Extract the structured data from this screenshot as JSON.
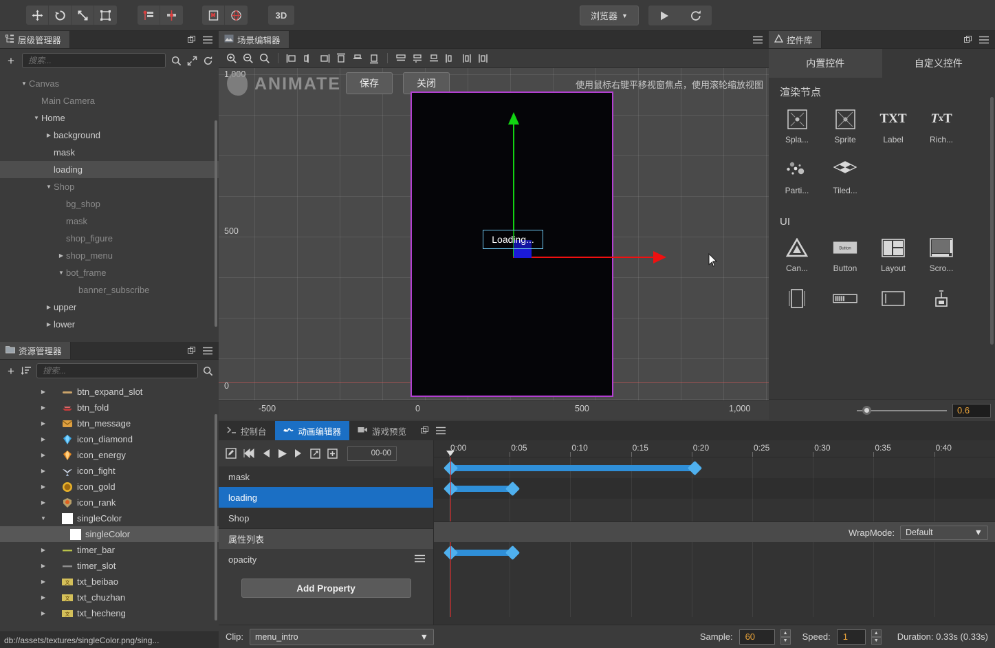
{
  "toolbar": {
    "transform_tools": [
      {
        "name": "move-tool",
        "icon": "move"
      },
      {
        "name": "rotate-tool",
        "icon": "rotate"
      },
      {
        "name": "scale-tool",
        "icon": "scale"
      },
      {
        "name": "rect-tool",
        "icon": "rect"
      }
    ],
    "pivot_tools": [
      {
        "name": "pivot-tool",
        "icon": "pivot"
      },
      {
        "name": "anchor-tool",
        "icon": "anchor"
      }
    ],
    "coord_tools": [
      {
        "name": "local-coord-tool",
        "icon": "local"
      },
      {
        "name": "global-coord-tool",
        "icon": "global"
      }
    ],
    "mode_3d_label": "3D",
    "browser_label": "浏览器",
    "browser_caret": "▼",
    "play_label": "play-icon",
    "refresh_label": "refresh-icon"
  },
  "hierarchy": {
    "title": "层级管理器",
    "search_placeholder": "搜索...",
    "add_label": "+",
    "nodes": [
      {
        "label": "Canvas",
        "depth": 1,
        "tri": "down",
        "dim": true,
        "sel": false
      },
      {
        "label": "Main Camera",
        "depth": 2,
        "tri": "none",
        "dim": true,
        "sel": false
      },
      {
        "label": "Home",
        "depth": 2,
        "tri": "down",
        "dim": false,
        "sel": false
      },
      {
        "label": "background",
        "depth": 3,
        "tri": "right",
        "dim": false,
        "sel": false
      },
      {
        "label": "mask",
        "depth": 3,
        "tri": "none",
        "dim": false,
        "sel": false
      },
      {
        "label": "loading",
        "depth": 3,
        "tri": "none",
        "dim": false,
        "sel": true
      },
      {
        "label": "Shop",
        "depth": 3,
        "tri": "down",
        "dim": true,
        "sel": false
      },
      {
        "label": "bg_shop",
        "depth": 4,
        "tri": "none",
        "dim": true,
        "sel": false
      },
      {
        "label": "mask",
        "depth": 4,
        "tri": "none",
        "dim": true,
        "sel": false
      },
      {
        "label": "shop_figure",
        "depth": 4,
        "tri": "none",
        "dim": true,
        "sel": false
      },
      {
        "label": "shop_menu",
        "depth": 4,
        "tri": "right",
        "dim": true,
        "sel": false
      },
      {
        "label": "bot_frame",
        "depth": 4,
        "tri": "down",
        "dim": true,
        "sel": false
      },
      {
        "label": "banner_subscribe",
        "depth": 5,
        "tri": "none",
        "dim": true,
        "sel": false
      },
      {
        "label": "upper",
        "depth": 3,
        "tri": "right",
        "dim": false,
        "sel": false
      },
      {
        "label": "lower",
        "depth": 3,
        "tri": "right",
        "dim": false,
        "sel": false
      }
    ]
  },
  "assets": {
    "title": "资源管理器",
    "search_placeholder": "搜索...",
    "add_label": "+",
    "items": [
      {
        "label": "btn_expand_slot",
        "tri": "right",
        "icon": "line-tan",
        "depth": 1,
        "sel": false
      },
      {
        "label": "btn_fold",
        "tri": "right",
        "icon": "sprite-red",
        "depth": 1,
        "sel": false
      },
      {
        "label": "btn_message",
        "tri": "right",
        "icon": "sprite-gold",
        "depth": 1,
        "sel": false
      },
      {
        "label": "icon_diamond",
        "tri": "right",
        "icon": "gem-blue",
        "depth": 1,
        "sel": false
      },
      {
        "label": "icon_energy",
        "tri": "right",
        "icon": "gem-orange",
        "depth": 1,
        "sel": false
      },
      {
        "label": "icon_fight",
        "tri": "right",
        "icon": "wings",
        "depth": 1,
        "sel": false
      },
      {
        "label": "icon_gold",
        "tri": "right",
        "icon": "coin-gold",
        "depth": 1,
        "sel": false
      },
      {
        "label": "icon_rank",
        "tri": "right",
        "icon": "crest",
        "depth": 1,
        "sel": false
      },
      {
        "label": "singleColor",
        "tri": "down",
        "icon": "white-swatch",
        "depth": 1,
        "sel": false
      },
      {
        "label": "singleColor",
        "tri": "none",
        "icon": "white-swatch",
        "depth": 2,
        "sel": true
      },
      {
        "label": "timer_bar",
        "tri": "right",
        "icon": "line-green",
        "depth": 1,
        "sel": false
      },
      {
        "label": "timer_slot",
        "tri": "right",
        "icon": "line-gray",
        "depth": 1,
        "sel": false
      },
      {
        "label": "txt_beibao",
        "tri": "right",
        "icon": "text-cn",
        "depth": 1,
        "sel": false
      },
      {
        "label": "txt_chuzhan",
        "tri": "right",
        "icon": "text-cn",
        "depth": 1,
        "sel": false
      },
      {
        "label": "txt_hecheng",
        "tri": "right",
        "icon": "text-cn",
        "depth": 1,
        "sel": false
      }
    ],
    "status_path": "db://assets/textures/singleColor.png/sing..."
  },
  "scene": {
    "title": "场景编辑器",
    "watermark": "ANIMATE",
    "save_label": "保存",
    "close_label": "关闭",
    "hint": "使用鼠标右键平移视窗焦点，使用滚轮缩放视图",
    "selected_node_label": "Loading...",
    "ruler_y": [
      "1,000",
      "500",
      "0"
    ],
    "ruler_x": [
      "-500",
      "0",
      "500",
      "1,000"
    ],
    "align_tools": [
      "align-left",
      "align-center-h",
      "align-right",
      "align-top",
      "align-middle-v",
      "align-bottom",
      "distribute-h-left",
      "distribute-h-center",
      "distribute-h-right"
    ],
    "zoom_tools": [
      "zoom-in-icon",
      "zoom-out-icon",
      "zoom-fit-icon"
    ]
  },
  "widgets": {
    "title": "控件库",
    "tabs": [
      {
        "label": "内置控件",
        "active": true
      },
      {
        "label": "自定义控件",
        "active": false
      }
    ],
    "sections": [
      {
        "title": "渲染节点",
        "items": [
          {
            "label": "Spla...",
            "icon": "splash-frame"
          },
          {
            "label": "Sprite",
            "icon": "sprite-frame"
          },
          {
            "label": "Label",
            "icon": "txt"
          },
          {
            "label": "Rich...",
            "icon": "rich-txt"
          },
          {
            "label": "Parti...",
            "icon": "particles"
          },
          {
            "label": "Tiled...",
            "icon": "tiled"
          }
        ]
      },
      {
        "title": "UI",
        "items": [
          {
            "label": "Can...",
            "icon": "canvas-tri"
          },
          {
            "label": "Button",
            "icon": "button"
          },
          {
            "label": "Layout",
            "icon": "layout"
          },
          {
            "label": "Scro...",
            "icon": "scrollview"
          },
          {
            "label": "",
            "icon": "pageview"
          },
          {
            "label": "",
            "icon": "progressbar"
          },
          {
            "label": "",
            "icon": "editbox"
          },
          {
            "label": "",
            "icon": "toggle"
          }
        ]
      }
    ],
    "zoom_value": "0.6"
  },
  "animation": {
    "tabs": [
      {
        "label": "控制台",
        "icon": "console-icon",
        "active": false
      },
      {
        "label": "动画编辑器",
        "icon": "anim-icon",
        "active": true
      },
      {
        "label": "游戏预览",
        "icon": "camera-icon",
        "active": false
      }
    ],
    "controls": [
      {
        "name": "edit-mode-button",
        "icon": "pencil-box"
      },
      {
        "name": "jump-start-button",
        "icon": "skip-back"
      },
      {
        "name": "prev-frame-button",
        "icon": "step-back"
      },
      {
        "name": "play-button",
        "icon": "play"
      },
      {
        "name": "next-frame-button",
        "icon": "step-fwd"
      },
      {
        "name": "jump-end-button",
        "icon": "skip-fwd"
      },
      {
        "name": "add-keyframe-button",
        "icon": "plus-box"
      }
    ],
    "time_display": "00-00",
    "tracks": [
      {
        "label": "mask",
        "selected": false
      },
      {
        "label": "loading",
        "selected": true
      },
      {
        "label": "Shop",
        "selected": false
      }
    ],
    "ruler_ticks": [
      "0:00",
      "0:05",
      "0:10",
      "0:15",
      "0:20",
      "0:25",
      "0:30",
      "0:35",
      "0:40"
    ],
    "property_list_title": "属性列表",
    "wrapmode_label": "WrapMode:",
    "wrapmode_value": "Default",
    "properties": [
      {
        "label": "opacity"
      }
    ],
    "add_property_label": "Add Property",
    "clip_label": "Clip:",
    "clip_value": "menu_intro",
    "sample_label": "Sample:",
    "sample_value": "60",
    "speed_label": "Speed:",
    "speed_value": "1",
    "duration_label": "Duration: 0.33s (0.33s)",
    "keyframes": {
      "mask": [
        {
          "t": 0
        },
        {
          "t": 355
        }
      ],
      "loading": [
        {
          "t": 0
        },
        {
          "t": 90
        }
      ],
      "opacity": [
        {
          "t": 0
        },
        {
          "t": 90
        }
      ]
    }
  },
  "colors": {
    "accent_blue": "#1b6fc4",
    "keyframe_blue": "#4fb0ee",
    "orange_value": "#e8a23a",
    "canvas_border": "#b23fd0",
    "gizmo_green": "#12d412",
    "gizmo_red": "#f01010",
    "gizmo_blue": "#1a1ad8"
  }
}
